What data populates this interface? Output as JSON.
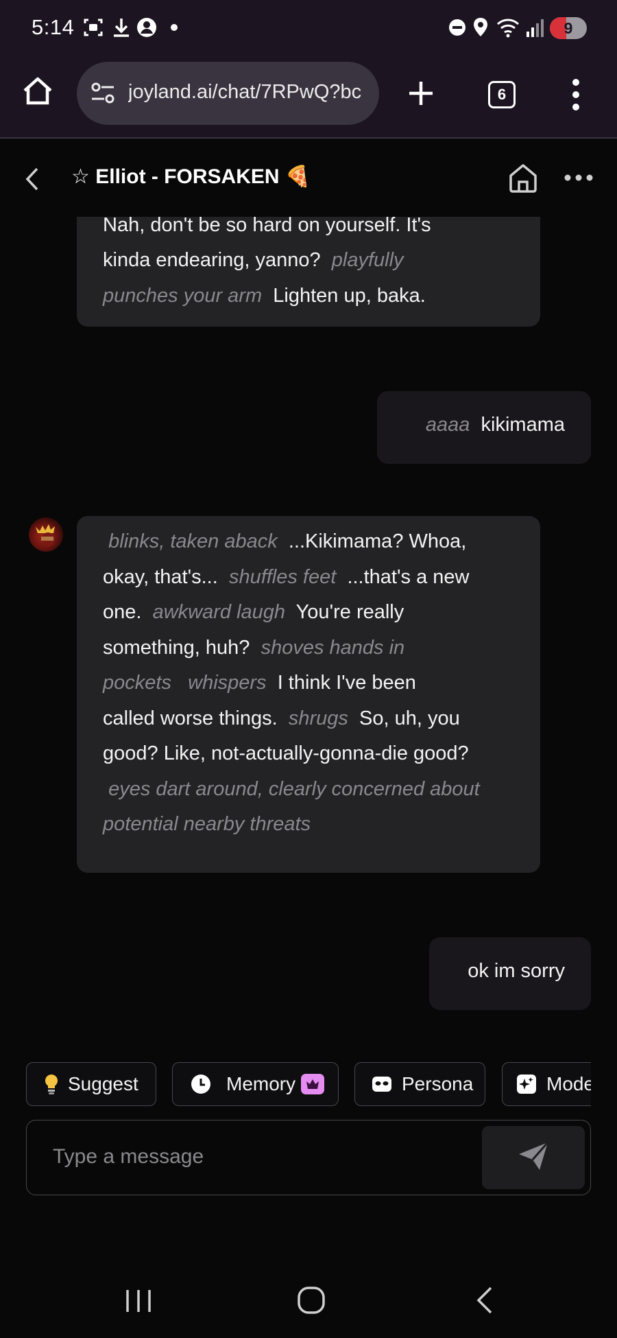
{
  "status_bar": {
    "time": "5:14",
    "battery": "9",
    "battery_color": "#d8313a"
  },
  "browser": {
    "url": "joyland.ai/chat/7RPwQ?bc",
    "tab_count": "6"
  },
  "header": {
    "title": "☆ Elliot - FORSAKEN 🍕"
  },
  "messages": {
    "m1": {
      "l1": "Nah, don't be so hard on yourself. It's",
      "l2a": "kinda endearing, yanno?",
      "l2b": "playfully",
      "l3a": "punches your arm",
      "l3b": "Lighten up, baka."
    },
    "m2": {
      "action": "aaaa",
      "text": "kikimama"
    },
    "m3": {
      "l1a": "blinks, taken aback",
      "l1b": "...Kikimama? Whoa,",
      "l2a": "okay, that's...",
      "l2b": "shuffles feet",
      "l2c": "...that's a new",
      "l3a": "one.",
      "l3b": "awkward laugh",
      "l3c": "You're really",
      "l4a": "something, huh?",
      "l4b": "shoves hands in",
      "l5a": "pockets",
      "l5b": "whispers",
      "l5c": "I think I've been",
      "l6a": "called worse things.",
      "l6b": "shrugs",
      "l6c": "So, uh, you",
      "l7": "good? Like, not-actually-gonna-die good?",
      "l8": "eyes dart around, clearly concerned about",
      "l9": "potential nearby threats"
    },
    "m4": {
      "text": "ok im sorry"
    }
  },
  "chips": {
    "suggest": "Suggest",
    "memory": "Memory",
    "persona": "Persona",
    "model": "Model"
  },
  "composer": {
    "placeholder": "Type a message"
  },
  "colors": {
    "bot_bubble": "#232325",
    "user_bubble": "#19171c",
    "action_text": "#8a8a8e",
    "memory_badge": "#e58cf0"
  }
}
